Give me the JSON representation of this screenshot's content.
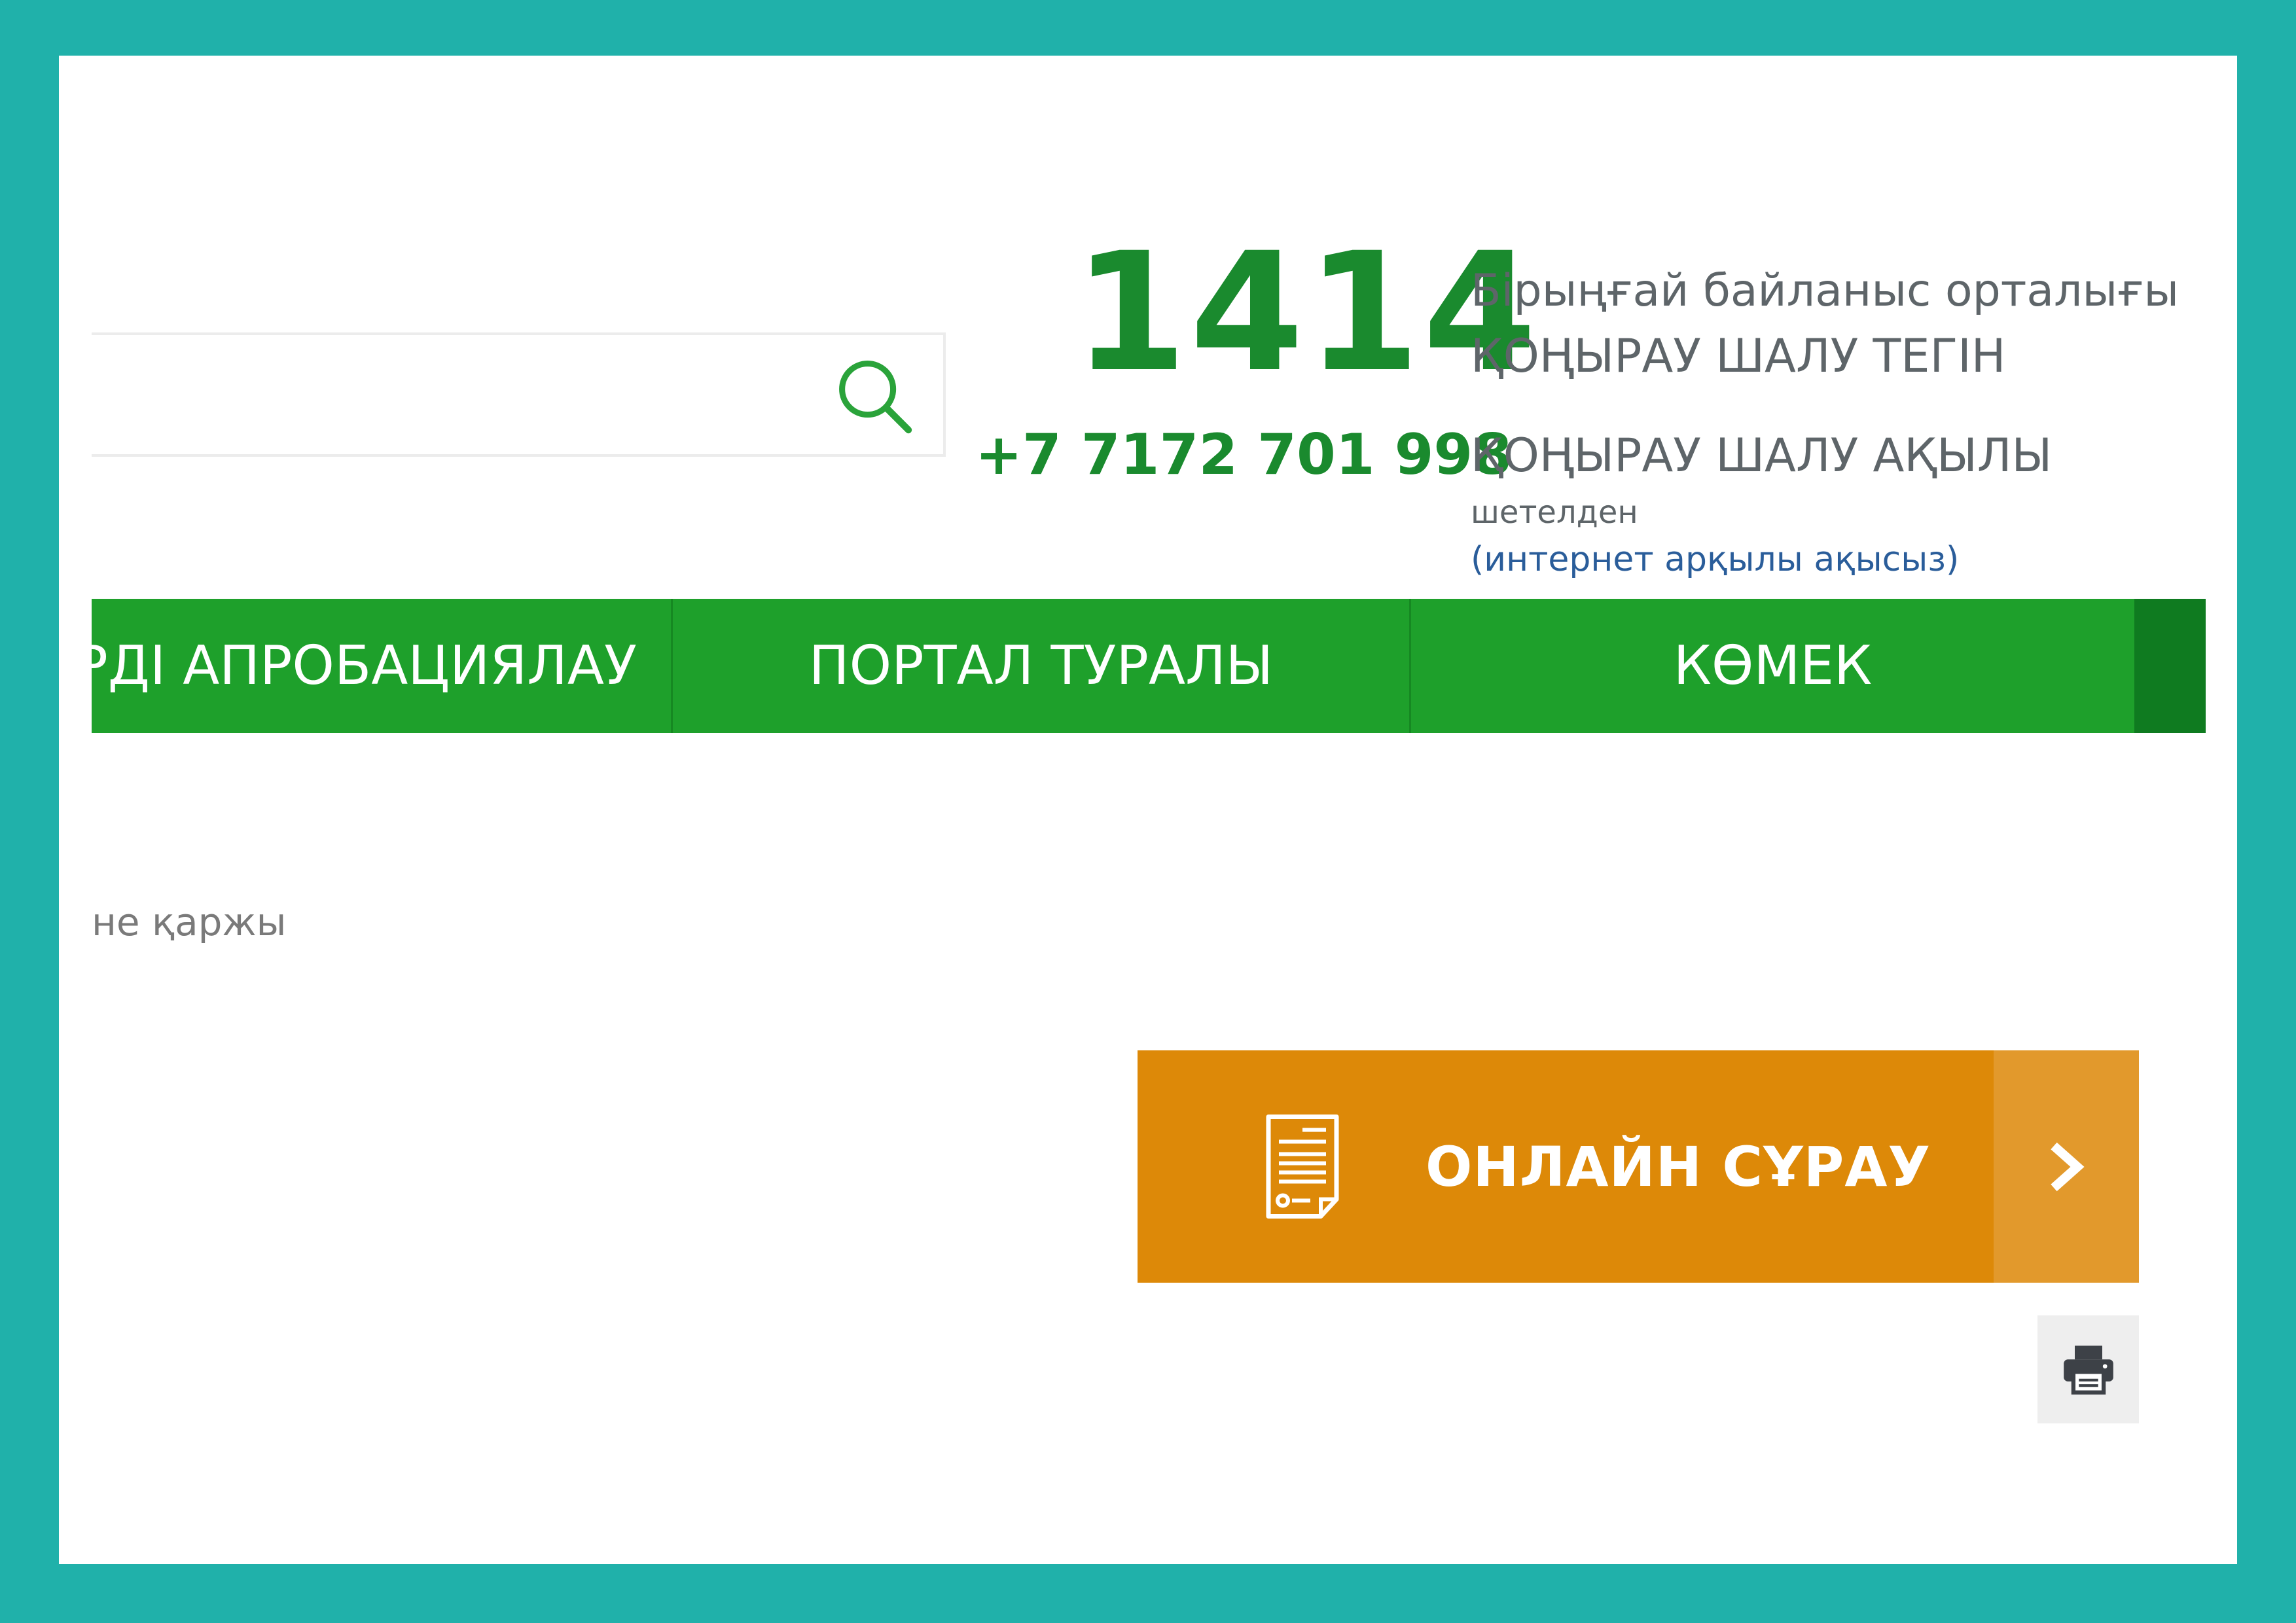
{
  "hotline": {
    "number": "1414",
    "title": "Бірыңғай байланыс орталығы",
    "free_label": "ҚОҢЫРАУ ШАЛУ ТЕГІН"
  },
  "phone": {
    "number": "+7 7172 701 998",
    "paid_label": "ҚОҢЫРАУ ШАЛУ АҚЫЛЫ",
    "abroad_label": "шетелден",
    "internet_link": "(интернет арқылы ақысыз)"
  },
  "search": {
    "value": "",
    "icon": "search-icon"
  },
  "nav": {
    "items": [
      {
        "label": "ЕРДІ АПРОБАЦИЯЛАУ"
      },
      {
        "label": "ПОРТАЛ ТУРАЛЫ"
      },
      {
        "label": "КӨМЕК"
      }
    ]
  },
  "breadcrumb": {
    "fragment": "не қаржы"
  },
  "online_request": {
    "label": "ОНЛАЙН СҰРАУ",
    "icon": "document-icon",
    "arrow_icon": "chevron-right-icon"
  },
  "print": {
    "icon": "print-icon"
  },
  "colors": {
    "frame": "#20b1aa",
    "nav_green": "#1ea02b",
    "hotline_green": "#1a8a2e",
    "button_orange": "#dd8908",
    "arrow_orange": "#e2992c",
    "link_blue": "#2a5d9a"
  }
}
